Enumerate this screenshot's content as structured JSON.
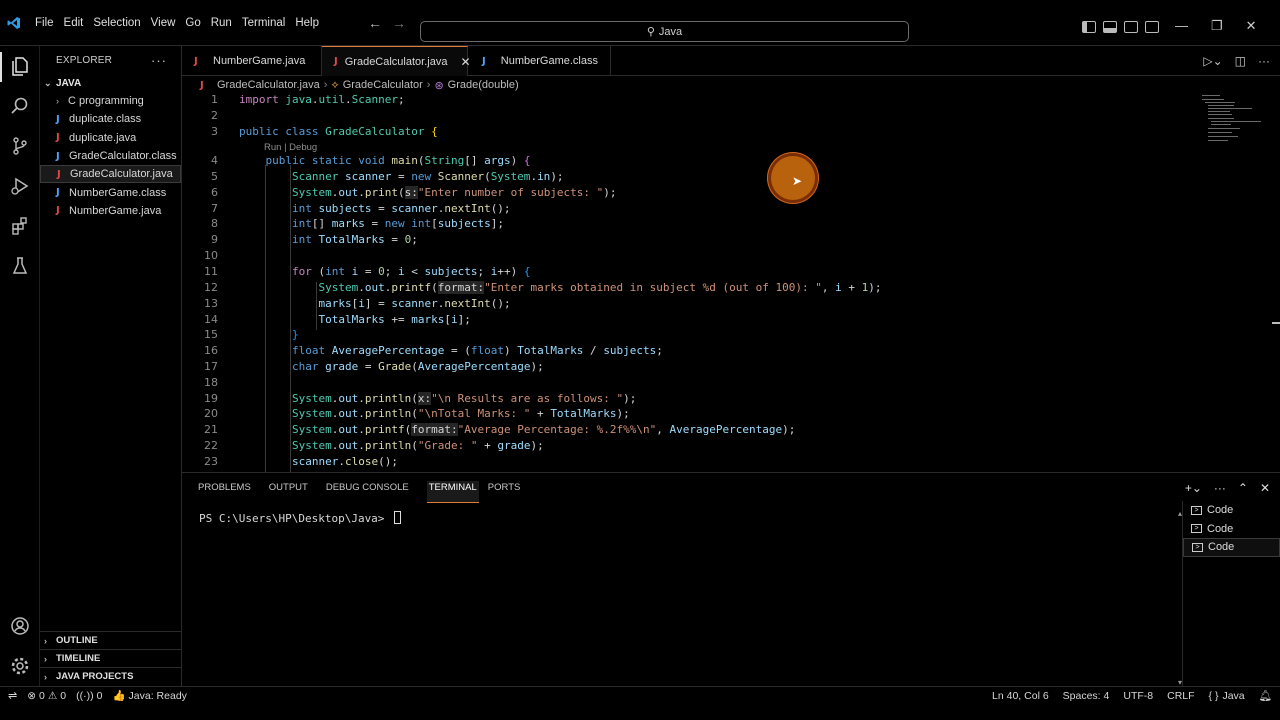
{
  "menu": [
    "File",
    "Edit",
    "Selection",
    "View",
    "Go",
    "Run",
    "Terminal",
    "Help"
  ],
  "search": {
    "text": "Java"
  },
  "explorer": {
    "title": "EXPLORER",
    "folder": "JAVA",
    "items": [
      {
        "label": "C programming",
        "kind": "folder"
      },
      {
        "label": "duplicate.class",
        "kind": "class"
      },
      {
        "label": "duplicate.java",
        "kind": "java"
      },
      {
        "label": "GradeCalculator.class",
        "kind": "class"
      },
      {
        "label": "GradeCalculator.java",
        "kind": "java"
      },
      {
        "label": "NumberGame.class",
        "kind": "class"
      },
      {
        "label": "NumberGame.java",
        "kind": "java"
      }
    ],
    "bottom_sections": [
      "OUTLINE",
      "TIMELINE",
      "JAVA PROJECTS"
    ]
  },
  "tabs": [
    {
      "label": "NumberGame.java"
    },
    {
      "label": "GradeCalculator.java"
    },
    {
      "label": "NumberGame.class"
    }
  ],
  "breadcrumb": [
    "GradeCalculator.java",
    "GradeCalculator",
    "Grade(double)"
  ],
  "editor": {
    "codelens": "Run | Debug",
    "line_numbers": [
      "1",
      "2",
      "3",
      "4",
      "5",
      "6",
      "7",
      "8",
      "9",
      "10",
      "11",
      "12",
      "13",
      "14",
      "15",
      "16",
      "17",
      "18",
      "19",
      "20",
      "21",
      "22",
      "23"
    ]
  },
  "panel": {
    "tabs": [
      "PROBLEMS",
      "OUTPUT",
      "DEBUG CONSOLE",
      "TERMINAL",
      "PORTS"
    ],
    "active_tab": "TERMINAL",
    "prompt": "PS C:\\Users\\HP\\Desktop\\Java> ",
    "terminals": [
      "Code",
      "Code",
      "Code"
    ]
  },
  "status": {
    "errors": "0",
    "warnings": "0",
    "ports": "0",
    "java": "Java: Ready",
    "position": "Ln 40, Col 6",
    "spaces": "Spaces: 4",
    "encoding": "UTF-8",
    "eol": "CRLF",
    "language": "Java"
  },
  "colors": {
    "accent_tab": "#e07b39",
    "java_icon": "#e04848",
    "class_icon": "#4fa3ff",
    "keyword": "#569cd6",
    "string": "#ce9178"
  }
}
